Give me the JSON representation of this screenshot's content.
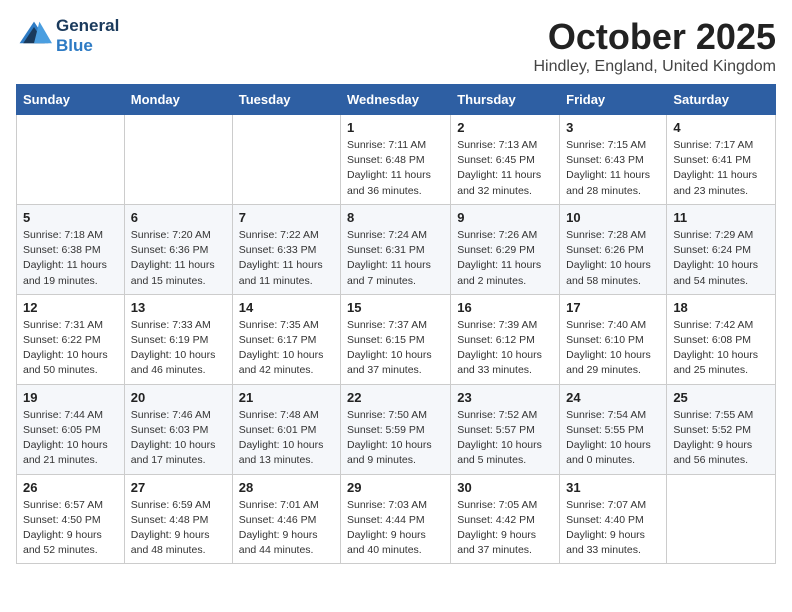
{
  "logo": {
    "line1": "General",
    "line2": "Blue"
  },
  "title": "October 2025",
  "subtitle": "Hindley, England, United Kingdom",
  "headers": [
    "Sunday",
    "Monday",
    "Tuesday",
    "Wednesday",
    "Thursday",
    "Friday",
    "Saturday"
  ],
  "weeks": [
    [
      {
        "day": "",
        "info": ""
      },
      {
        "day": "",
        "info": ""
      },
      {
        "day": "",
        "info": ""
      },
      {
        "day": "1",
        "info": "Sunrise: 7:11 AM\nSunset: 6:48 PM\nDaylight: 11 hours and 36 minutes."
      },
      {
        "day": "2",
        "info": "Sunrise: 7:13 AM\nSunset: 6:45 PM\nDaylight: 11 hours and 32 minutes."
      },
      {
        "day": "3",
        "info": "Sunrise: 7:15 AM\nSunset: 6:43 PM\nDaylight: 11 hours and 28 minutes."
      },
      {
        "day": "4",
        "info": "Sunrise: 7:17 AM\nSunset: 6:41 PM\nDaylight: 11 hours and 23 minutes."
      }
    ],
    [
      {
        "day": "5",
        "info": "Sunrise: 7:18 AM\nSunset: 6:38 PM\nDaylight: 11 hours and 19 minutes."
      },
      {
        "day": "6",
        "info": "Sunrise: 7:20 AM\nSunset: 6:36 PM\nDaylight: 11 hours and 15 minutes."
      },
      {
        "day": "7",
        "info": "Sunrise: 7:22 AM\nSunset: 6:33 PM\nDaylight: 11 hours and 11 minutes."
      },
      {
        "day": "8",
        "info": "Sunrise: 7:24 AM\nSunset: 6:31 PM\nDaylight: 11 hours and 7 minutes."
      },
      {
        "day": "9",
        "info": "Sunrise: 7:26 AM\nSunset: 6:29 PM\nDaylight: 11 hours and 2 minutes."
      },
      {
        "day": "10",
        "info": "Sunrise: 7:28 AM\nSunset: 6:26 PM\nDaylight: 10 hours and 58 minutes."
      },
      {
        "day": "11",
        "info": "Sunrise: 7:29 AM\nSunset: 6:24 PM\nDaylight: 10 hours and 54 minutes."
      }
    ],
    [
      {
        "day": "12",
        "info": "Sunrise: 7:31 AM\nSunset: 6:22 PM\nDaylight: 10 hours and 50 minutes."
      },
      {
        "day": "13",
        "info": "Sunrise: 7:33 AM\nSunset: 6:19 PM\nDaylight: 10 hours and 46 minutes."
      },
      {
        "day": "14",
        "info": "Sunrise: 7:35 AM\nSunset: 6:17 PM\nDaylight: 10 hours and 42 minutes."
      },
      {
        "day": "15",
        "info": "Sunrise: 7:37 AM\nSunset: 6:15 PM\nDaylight: 10 hours and 37 minutes."
      },
      {
        "day": "16",
        "info": "Sunrise: 7:39 AM\nSunset: 6:12 PM\nDaylight: 10 hours and 33 minutes."
      },
      {
        "day": "17",
        "info": "Sunrise: 7:40 AM\nSunset: 6:10 PM\nDaylight: 10 hours and 29 minutes."
      },
      {
        "day": "18",
        "info": "Sunrise: 7:42 AM\nSunset: 6:08 PM\nDaylight: 10 hours and 25 minutes."
      }
    ],
    [
      {
        "day": "19",
        "info": "Sunrise: 7:44 AM\nSunset: 6:05 PM\nDaylight: 10 hours and 21 minutes."
      },
      {
        "day": "20",
        "info": "Sunrise: 7:46 AM\nSunset: 6:03 PM\nDaylight: 10 hours and 17 minutes."
      },
      {
        "day": "21",
        "info": "Sunrise: 7:48 AM\nSunset: 6:01 PM\nDaylight: 10 hours and 13 minutes."
      },
      {
        "day": "22",
        "info": "Sunrise: 7:50 AM\nSunset: 5:59 PM\nDaylight: 10 hours and 9 minutes."
      },
      {
        "day": "23",
        "info": "Sunrise: 7:52 AM\nSunset: 5:57 PM\nDaylight: 10 hours and 5 minutes."
      },
      {
        "day": "24",
        "info": "Sunrise: 7:54 AM\nSunset: 5:55 PM\nDaylight: 10 hours and 0 minutes."
      },
      {
        "day": "25",
        "info": "Sunrise: 7:55 AM\nSunset: 5:52 PM\nDaylight: 9 hours and 56 minutes."
      }
    ],
    [
      {
        "day": "26",
        "info": "Sunrise: 6:57 AM\nSunset: 4:50 PM\nDaylight: 9 hours and 52 minutes."
      },
      {
        "day": "27",
        "info": "Sunrise: 6:59 AM\nSunset: 4:48 PM\nDaylight: 9 hours and 48 minutes."
      },
      {
        "day": "28",
        "info": "Sunrise: 7:01 AM\nSunset: 4:46 PM\nDaylight: 9 hours and 44 minutes."
      },
      {
        "day": "29",
        "info": "Sunrise: 7:03 AM\nSunset: 4:44 PM\nDaylight: 9 hours and 40 minutes."
      },
      {
        "day": "30",
        "info": "Sunrise: 7:05 AM\nSunset: 4:42 PM\nDaylight: 9 hours and 37 minutes."
      },
      {
        "day": "31",
        "info": "Sunrise: 7:07 AM\nSunset: 4:40 PM\nDaylight: 9 hours and 33 minutes."
      },
      {
        "day": "",
        "info": ""
      }
    ]
  ]
}
